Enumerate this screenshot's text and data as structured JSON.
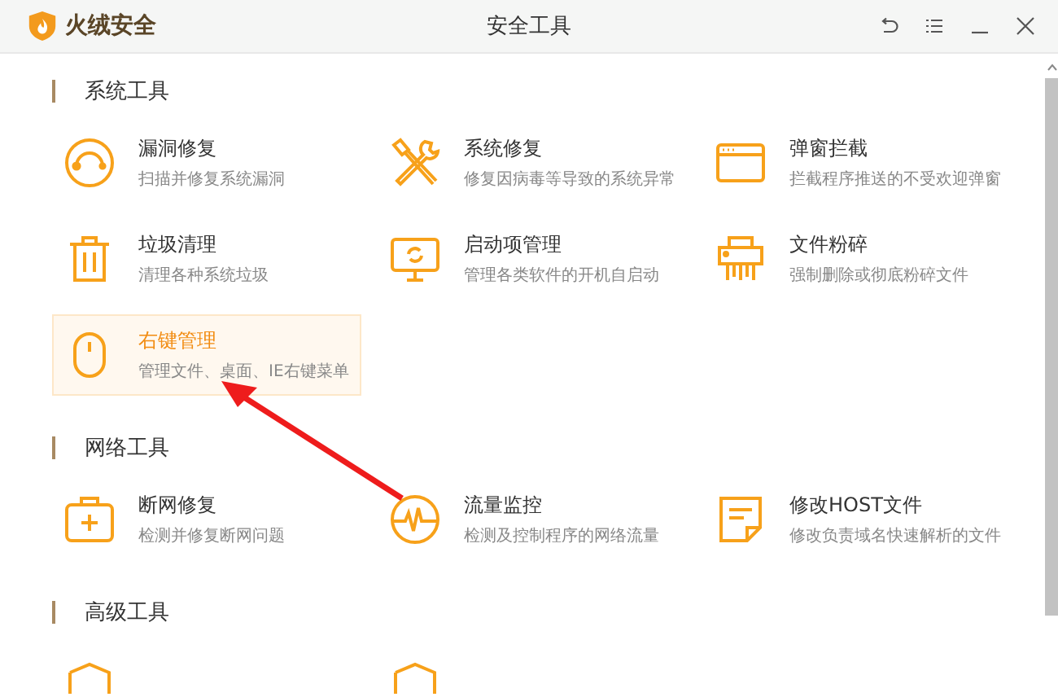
{
  "app": {
    "name": "火绒安全"
  },
  "window": {
    "title": "安全工具"
  },
  "sections": [
    {
      "title": "系统工具",
      "items": [
        {
          "title": "漏洞修复",
          "description": "扫描并修复系统漏洞",
          "selected": false
        },
        {
          "title": "系统修复",
          "description": "修复因病毒等导致的系统异常",
          "selected": false
        },
        {
          "title": "弹窗拦截",
          "description": "拦截程序推送的不受欢迎弹窗",
          "selected": false
        },
        {
          "title": "垃圾清理",
          "description": "清理各种系统垃圾",
          "selected": false
        },
        {
          "title": "启动项管理",
          "description": "管理各类软件的开机自启动",
          "selected": false
        },
        {
          "title": "文件粉碎",
          "description": "强制删除或彻底粉碎文件",
          "selected": false
        },
        {
          "title": "右键管理",
          "description": "管理文件、桌面、IE右键菜单",
          "selected": true
        }
      ]
    },
    {
      "title": "网络工具",
      "items": [
        {
          "title": "断网修复",
          "description": "检测并修复断网问题",
          "selected": false
        },
        {
          "title": "流量监控",
          "description": "检测及控制程序的网络流量",
          "selected": false
        },
        {
          "title": "修改HOST文件",
          "description": "修改负责域名快速解析的文件",
          "selected": false
        }
      ]
    },
    {
      "title": "高级工具",
      "items": [
        {
          "selected": false
        },
        {
          "selected": false
        }
      ]
    }
  ]
}
